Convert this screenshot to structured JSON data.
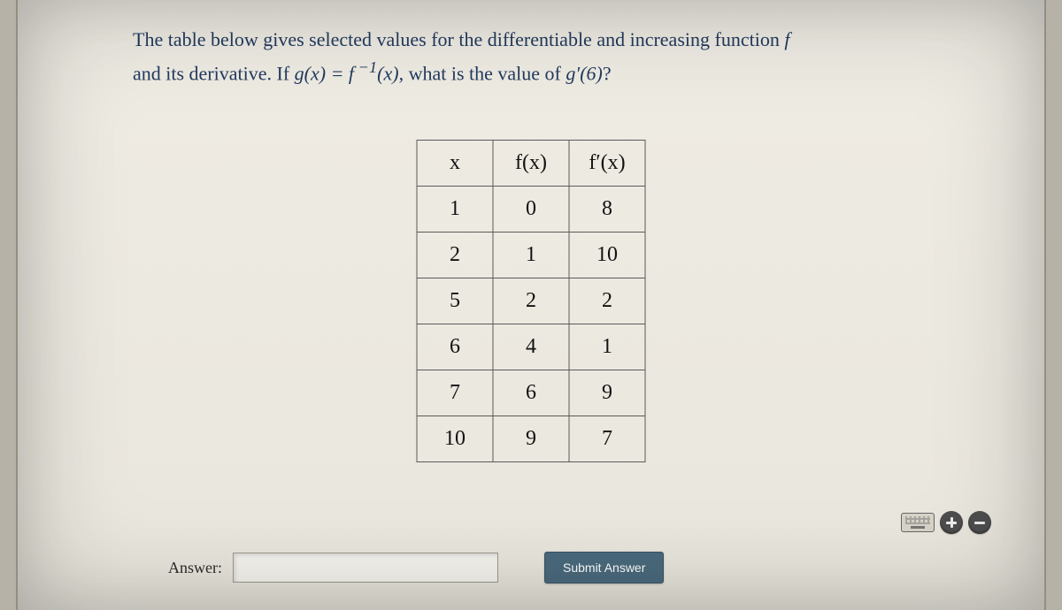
{
  "prompt": {
    "line1_pre": "The table below gives selected values for the differentiable and increasing function ",
    "line1_f": "f",
    "line2_pre": "and its derivative. If ",
    "eq_lhs": "g(x) = f",
    "eq_exp": " −1",
    "eq_rhs": "(x)",
    "line2_mid": ", what is the value of ",
    "gprime": "g′(6)",
    "line2_end": "?"
  },
  "table": {
    "headers": {
      "x": "x",
      "fx": "f(x)",
      "fpx": "f′(x)"
    },
    "rows": [
      {
        "x": "1",
        "fx": "0",
        "fpx": "8"
      },
      {
        "x": "2",
        "fx": "1",
        "fpx": "10"
      },
      {
        "x": "5",
        "fx": "2",
        "fpx": "2"
      },
      {
        "x": "6",
        "fx": "4",
        "fpx": "1"
      },
      {
        "x": "7",
        "fx": "6",
        "fpx": "9"
      },
      {
        "x": "10",
        "fx": "9",
        "fpx": "7"
      }
    ]
  },
  "answer": {
    "label": "Answer:",
    "value": "",
    "submit": "Submit Answer"
  }
}
